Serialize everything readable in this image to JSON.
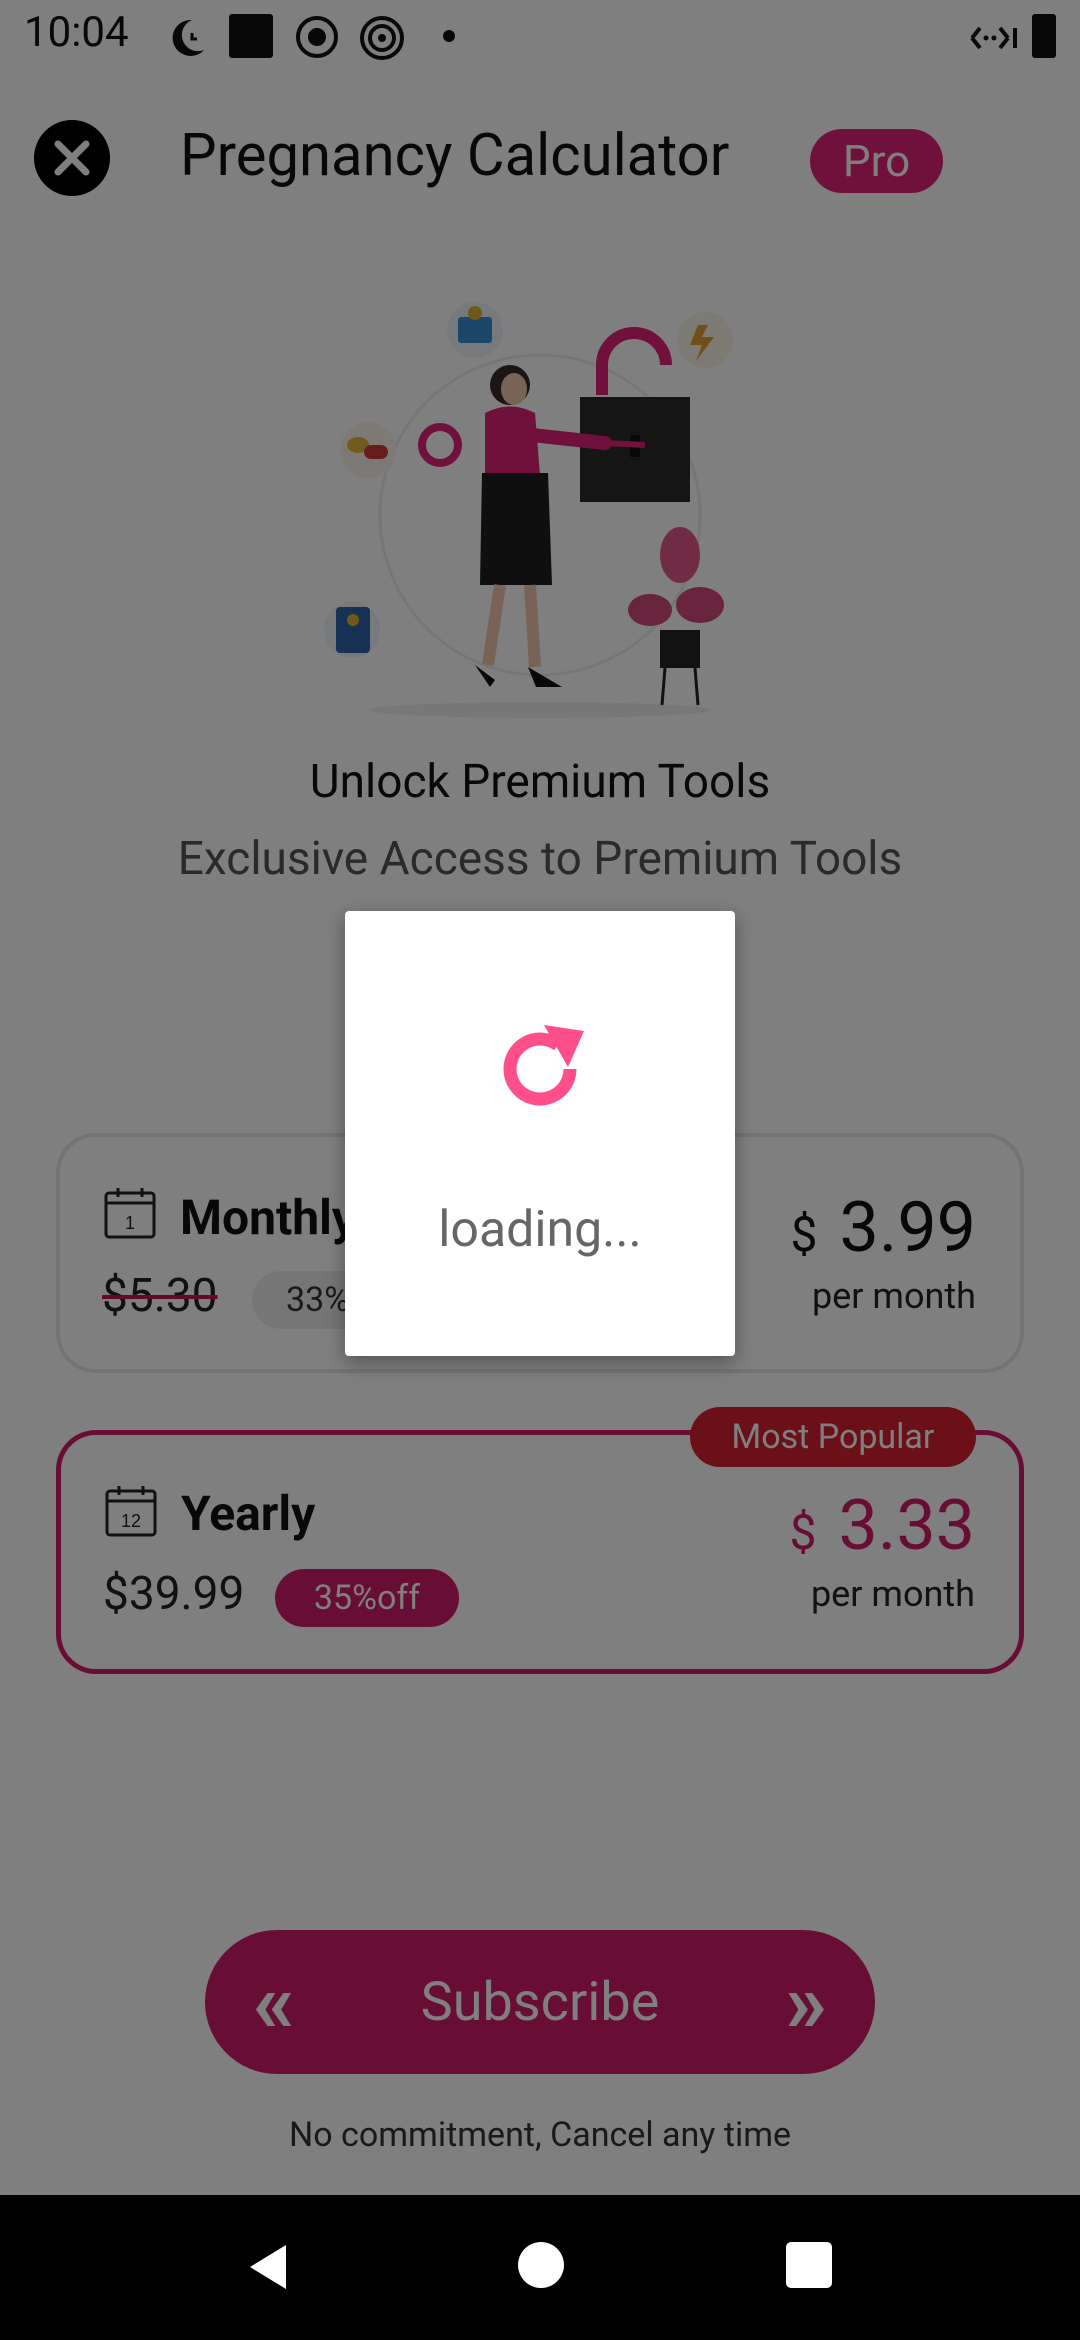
{
  "status_bar": {
    "time": "10:04",
    "icons": [
      "moon-clock-icon",
      "square-icon",
      "record-icon",
      "target-icon",
      "dot-icon",
      "data-saver-icon",
      "battery-icon"
    ]
  },
  "header": {
    "close_icon": "close-icon",
    "title": "Pregnancy Calculator",
    "badge": "Pro"
  },
  "hero": {
    "title": "Unlock Premium Tools",
    "subtitle": "Exclusive Access to Premium Tools"
  },
  "plans": {
    "monthly": {
      "calendar_number": "1",
      "name": "Monthly",
      "old_price": "$5.30",
      "discount": "33%",
      "currency": "$",
      "price": "3.99",
      "per": "per month"
    },
    "yearly": {
      "calendar_number": "12",
      "name": "Yearly",
      "old_price": "$39.99",
      "discount": "35%off",
      "currency": "$",
      "price": "3.33",
      "per": "per month",
      "badge": "Most Popular"
    }
  },
  "subscribe": {
    "label": "Subscribe",
    "disclaimer": "No commitment, Cancel any time"
  },
  "dialog": {
    "icon": "refresh-icon",
    "text": "loading..."
  },
  "colors": {
    "accent": "#d11a6a",
    "badge_red": "#d6202e",
    "loading_icon": "#ff4f8b"
  }
}
